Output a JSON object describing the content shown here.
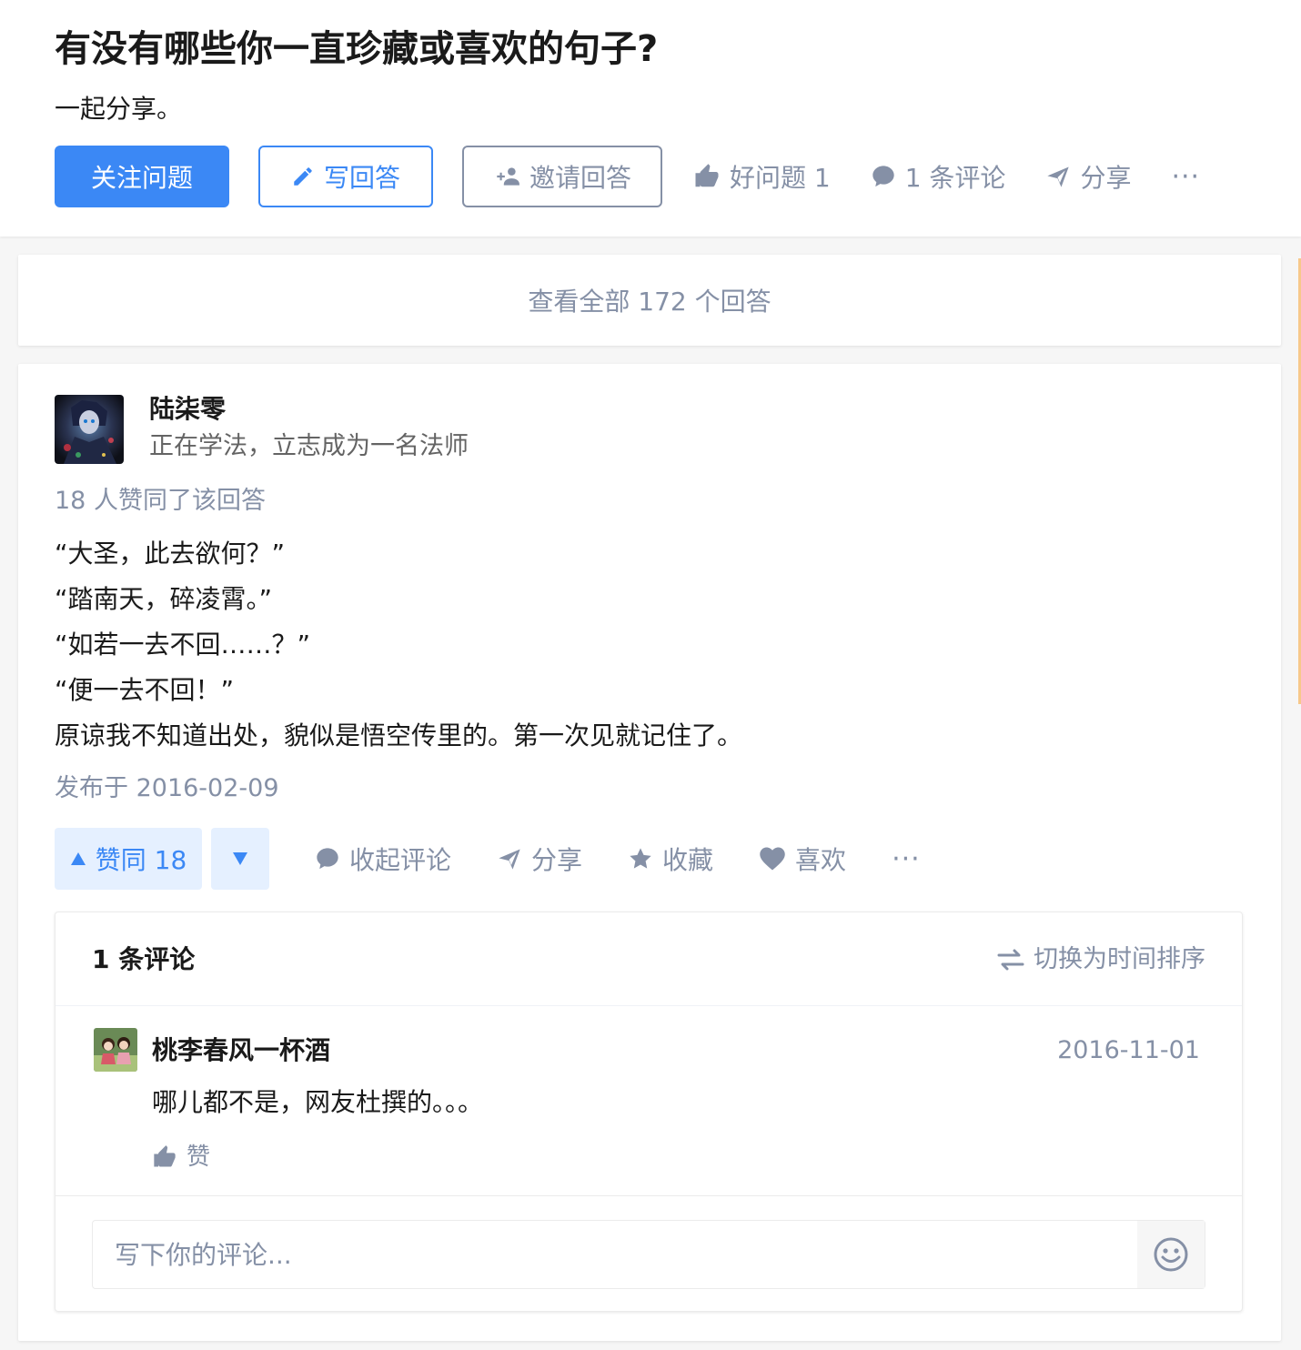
{
  "question": {
    "title": "有没有哪些你一直珍藏或喜欢的句子?",
    "detail": "一起分享。",
    "actions": {
      "follow_label": "关注问题",
      "write_answer_label": "写回答",
      "invite_label": "邀请回答",
      "good_question_label": "好问题 1",
      "comments_label": "1 条评论",
      "share_label": "分享",
      "more_label": "···"
    }
  },
  "view_all_label": "查看全部 172 个回答",
  "answer": {
    "author": {
      "name": "陆柒零",
      "bio": "正在学法，立志成为一名法师"
    },
    "votes_text": "18 人赞同了该回答",
    "content": [
      "“大圣，此去欲何？”",
      "“踏南天，碎凌霄。”",
      "“如若一去不回……？”",
      "“便一去不回！”",
      "原谅我不知道出处，貌似是悟空传里的。第一次见就记住了。"
    ],
    "published": "发布于 2016-02-09",
    "actions": {
      "upvote_label": "赞同 18",
      "collapse_comments_label": "收起评论",
      "share_label": "分享",
      "collect_label": "收藏",
      "like_label": "喜欢",
      "more_label": "···"
    }
  },
  "comments": {
    "count_label": "1 条评论",
    "sort_switch_label": "切换为时间排序",
    "items": [
      {
        "user": "桃李春风一杯酒",
        "time": "2016-11-01",
        "text": "哪儿都不是，网友杜撰的。。。",
        "like_label": "赞"
      }
    ],
    "input_placeholder": "写下你的评论..."
  },
  "colors": {
    "primary": "#3b88f5",
    "secondary_text": "#8590a6",
    "primary_light_bg": "#e5f0ff"
  }
}
